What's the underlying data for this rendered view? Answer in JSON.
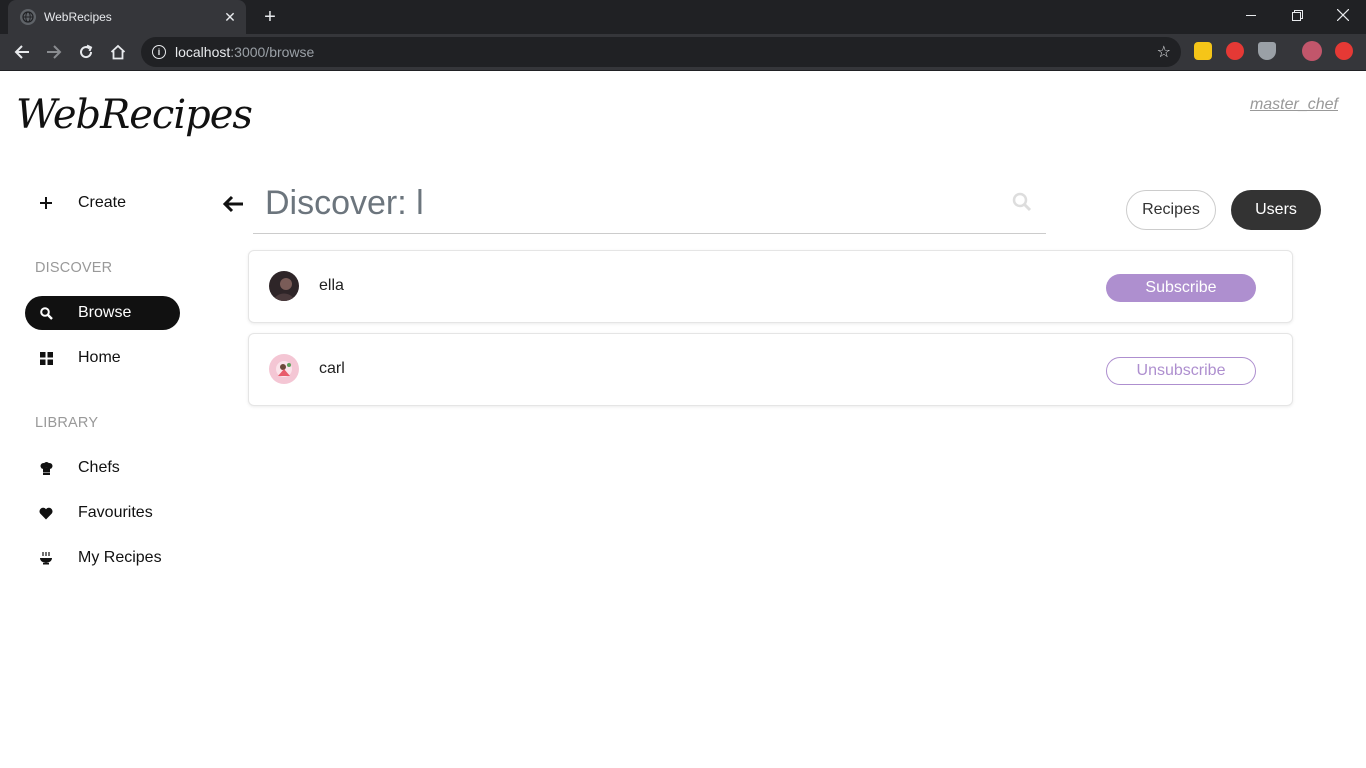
{
  "browser": {
    "tab_title": "WebRecipes",
    "url_host": "localhost",
    "url_rest": ":3000/browse"
  },
  "app": {
    "logo": "WebRecipes",
    "current_user": "master_chef"
  },
  "sidebar": {
    "create_label": "Create",
    "discover_heading": "DISCOVER",
    "library_heading": "LIBRARY",
    "items": [
      {
        "label": "Browse",
        "icon": "search-icon"
      },
      {
        "label": "Home",
        "icon": "grid-icon"
      },
      {
        "label": "Chefs",
        "icon": "chef-hat-icon"
      },
      {
        "label": "Favourites",
        "icon": "heart-icon"
      },
      {
        "label": "My Recipes",
        "icon": "bowl-icon"
      }
    ]
  },
  "search": {
    "query": "Discover: l"
  },
  "toggles": {
    "recipes": "Recipes",
    "users": "Users"
  },
  "results": [
    {
      "name": "ella",
      "action": "Subscribe"
    },
    {
      "name": "carl",
      "action": "Unsubscribe"
    }
  ],
  "colors": {
    "accent": "#ae8fcf",
    "dark": "#333333"
  }
}
